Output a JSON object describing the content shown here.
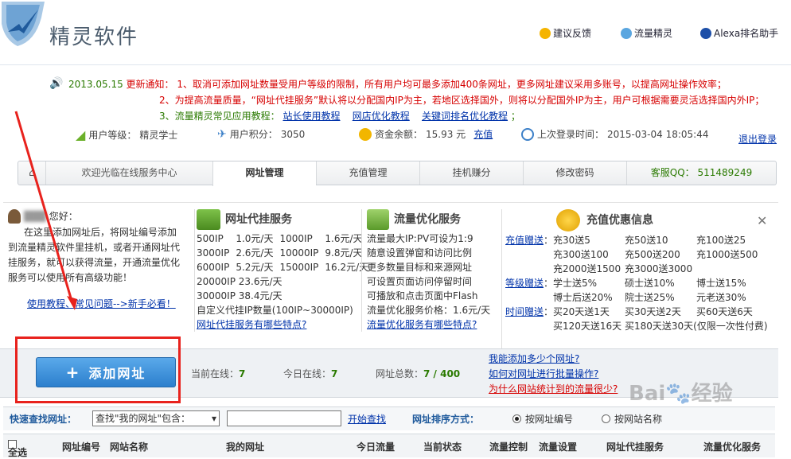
{
  "header": {
    "title": "精灵软件",
    "links": [
      "建议反馈",
      "流量精灵",
      "Alexa排名助手"
    ]
  },
  "notice": {
    "date": "2013.05.15",
    "label": "更新通知：",
    "item1": "1、取消可添加网址数量受用户等级的限制，所有用户均可最多添加400条网址，更多网址建议采用多账号，以提高网址操作效率；",
    "item2": "2、为提高流量质量，“网址代挂服务”默认将以分配国内IP为主，若地区选择国外，则将以分配国外IP为主，用户可根据需要灵活选择国内外IP；",
    "item3_prefix": "3、流量精灵常见应用教程：",
    "item3_links": [
      "站长使用教程",
      "网店优化教程",
      "关键词排名优化教程"
    ],
    "item3_suffix": "；"
  },
  "info": {
    "level_label": "用户等级：",
    "level_value": "精灵学士",
    "points_label": "用户积分：",
    "points_value": "3050",
    "balance_label": "资金余额：",
    "balance_value": "15.93 元",
    "recharge": "充值",
    "login_label": "上次登录时间：",
    "login_value": "2015-03-04 18:05:44",
    "logout": "退出登录"
  },
  "tabs": {
    "welcome": "欢迎光临在线服务中心",
    "items": [
      "网址管理",
      "充值管理",
      "挂机赚分",
      "修改密码"
    ],
    "qq": "客服QQ：",
    "qq_number": "511489249"
  },
  "greeting": {
    "hello": "您好：",
    "text": "在这里添加网址后，将网址编号添加到流量精灵软件里挂机，或者开通网址代挂服务，就可以获得流量，开通流量优化服务可以使用所有高级功能！",
    "link": "使用教程、常见问题-->新手必看！"
  },
  "proxy": {
    "title": "网址代挂服务",
    "prices": [
      [
        "500IP",
        "1.0元/天",
        "1000IP",
        "1.6元/天"
      ],
      [
        "3000IP",
        "2.6元/天",
        "10000IP",
        "9.8元/天"
      ],
      [
        "6000IP",
        "5.2元/天",
        "15000IP",
        "16.2元/天"
      ]
    ],
    "p20000": "20000IP 23.6元/天",
    "p30000": "30000IP 38.4元/天",
    "custom": "自定义代挂IP数量(100IP~30000IP)",
    "link": "网址代挂服务有哪些特点?"
  },
  "optimize": {
    "title": "流量优化服务",
    "lines": [
      "流量最大IP:PV可设为1:9",
      "随意设置弹窗和访问比例",
      "更多数量目标和来源网址",
      "可设置页面访问停留时间",
      "可播放和点击页面中Flash",
      "流量优化服务价格：1.6元/天"
    ],
    "link": "流量优化服务有哪些特点?"
  },
  "recharge": {
    "title": "充值优惠信息",
    "r1_label": "充值赠送",
    "r1": [
      "充30送5",
      "充50送10",
      "充100送25",
      "充300送100",
      "充500送200",
      "充1000送500",
      "充2000送1500",
      "充3000送3000"
    ],
    "r2_label": "等级赠送",
    "r2": [
      "学士送5%",
      "硕士送10%",
      "博士送15%",
      "博士后送20%",
      "院士送25%",
      "元老送30%"
    ],
    "r3_label": "时间赠送",
    "r3": [
      "买20天送1天",
      "买30天送2天",
      "买60天送6天",
      "买120天送16天",
      "买180天送30天(仅限一次性付费)"
    ]
  },
  "actions": {
    "add": "添加网址",
    "online_label": "当前在线：",
    "online": "7",
    "today_label": "今日在线：",
    "today": "7",
    "total_label": "网址总数：",
    "total": "7 / 400",
    "help1": "我能添加多少个网址?",
    "help2": "如何对网址进行批量操作?",
    "help3": "为什么网站统计到的流量很少?"
  },
  "search": {
    "label": "快速查找网址：",
    "select": "查找\"我的网址\"包含：",
    "button": "开始查找",
    "sort_label": "网址排序方式：",
    "sort1": "按网址编号",
    "sort2": "按网站名称"
  },
  "table_header": [
    "全选",
    "网址编号",
    "网站名称",
    "我的网址",
    "今日流量",
    "当前状态",
    "流量控制",
    "流量设置",
    "网址代挂服务",
    "流量优化服务"
  ],
  "colors": {
    "red": "#d60000",
    "link": "#0033aa",
    "accent": "#2c7fcd"
  }
}
